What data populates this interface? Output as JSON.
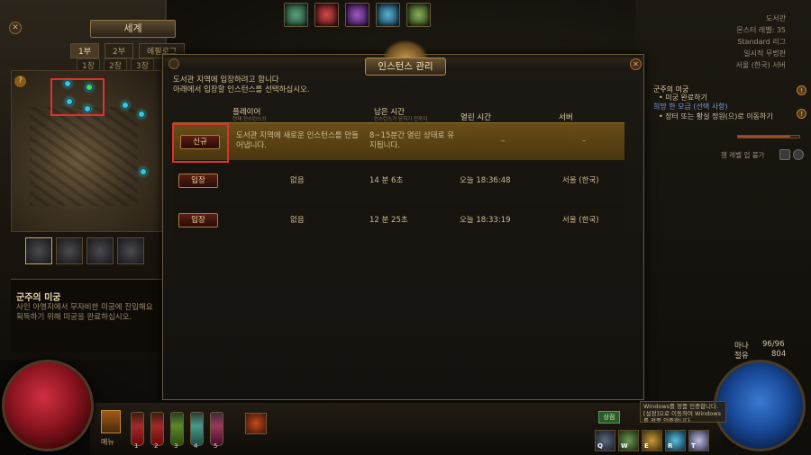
{
  "top_skills": [
    {
      "name": "skill-icon-1",
      "color": "#3a7a5a"
    },
    {
      "name": "skill-icon-2",
      "color": "#a02a2a"
    },
    {
      "name": "skill-icon-3",
      "color": "#7a3a9a"
    },
    {
      "name": "skill-icon-4",
      "color": "#3a8aaa"
    },
    {
      "name": "skill-icon-5",
      "color": "#6a8a3a"
    }
  ],
  "world": {
    "title": "세계",
    "acts": [
      "1부",
      "2부",
      "에필로그"
    ],
    "parts": [
      "1장",
      "2장",
      "3장"
    ],
    "zone_title": "군주의 미궁",
    "zone_desc": "사인 아영지에서 무자비한 미궁에 진입해요 획득하기 위해 미궁을 완료하십시오."
  },
  "modal": {
    "title": "인스턴스 관리",
    "intro_line1": "도서관 지역에 입장하려고 합니다",
    "intro_line2": "아래에서 입장할 인스턴스를 선택하십시오.",
    "headers": {
      "player": "플레이어",
      "player_sub": "현재 인스턴스의",
      "time_left": "남은 시간",
      "time_left_sub": "인스턴스가 닫히기 전까지",
      "opened": "열린 시간",
      "server": "서버"
    },
    "rows": [
      {
        "button": "신규",
        "player": "도서관 지역에 새로운 인스턴스를 만들어냅니다.",
        "time_left": "8~15분간 열린 상태로 유지됩니다.",
        "opened": "–",
        "server": "–"
      },
      {
        "button": "입장",
        "player": "없음",
        "time_left": "14 분 6초",
        "opened": "오늘 18:36:48",
        "server": "서울 (한국)"
      },
      {
        "button": "입장",
        "player": "없음",
        "time_left": "12 분 25초",
        "opened": "오늘 18:33:19",
        "server": "서울 (한국)"
      }
    ]
  },
  "right_panel": {
    "location": "도서관",
    "monster_level": "몬스터 레벨: 35",
    "league": "Standard 리그",
    "temp_zone": "일시적 무법판",
    "server": "서울 (한국) 서버",
    "quest1_title": "군주의 미궁",
    "quest1_item": "미궁 완료하기",
    "quest2_title": "희망 한 모금 (선택 사항)",
    "quest2_item": "장터 또는 황실 정원(으)로 이동하기",
    "ladder": "챔 레벨 업 불가",
    "mana_label": "마나",
    "mana_value": "96/96",
    "reserve_label": "절유",
    "reserve_value": "804",
    "xp_fraction": 0.85
  },
  "bottom": {
    "menu_label": "메뉴",
    "flask_numbers": [
      "1",
      "2",
      "3",
      "4",
      "5"
    ],
    "status_label": "상점",
    "hotkeys": [
      "Q",
      "W",
      "E",
      "R",
      "T"
    ],
    "toast_text": "Windows를 정품 인증합니다.",
    "toast_detail": "[설정]으로 이동하여 Windows를 정품 인증합니다."
  }
}
